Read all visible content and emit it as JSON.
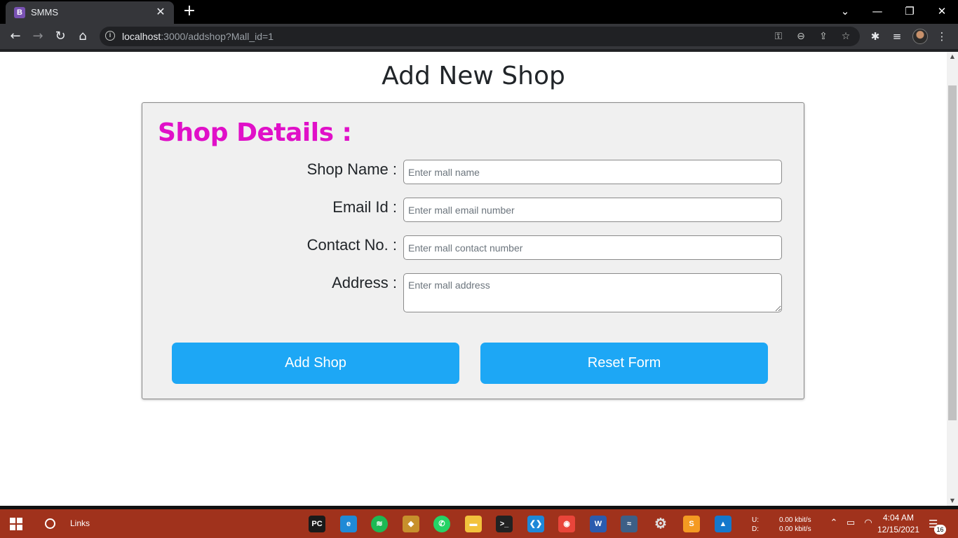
{
  "browser": {
    "tab": {
      "favicon": "B",
      "title": "SMMS",
      "close": "✕"
    },
    "new_tab": "+",
    "window_controls": {
      "dropdown": "⌄",
      "minimize": "—",
      "restore": "❐",
      "close": "✕"
    },
    "nav": {
      "back": "←",
      "forward": "→",
      "reload": "↻",
      "home": "⌂"
    },
    "url_host": "localhost",
    "url_rest": ":3000/addshop?Mall_id=1",
    "omnibox_icons": {
      "key": "⚿",
      "zoom": "⊖",
      "share": "⇪",
      "bookmark": "☆"
    },
    "toolbar_icons": {
      "extensions": "✱",
      "media": "≡"
    }
  },
  "page": {
    "title": "Add New Shop",
    "section_title": "Shop Details :",
    "accent_color": "#e010c8",
    "button_color": "#1da7f5",
    "fields": {
      "shop_name": {
        "label": "Shop Name :",
        "value": "",
        "placeholder": "Enter mall name"
      },
      "email": {
        "label": "Email Id :",
        "value": "",
        "placeholder": "Enter mall email number"
      },
      "contact": {
        "label": "Contact No. :",
        "value": "",
        "placeholder": "Enter mall contact number"
      },
      "address": {
        "label": "Address :",
        "value": "",
        "placeholder": "Enter mall address"
      }
    },
    "buttons": {
      "submit": "Add Shop",
      "reset": "Reset Form"
    }
  },
  "scrollbar": {
    "up": "▲",
    "down": "▼"
  },
  "taskbar": {
    "links_label": "Links",
    "apps": [
      {
        "name": "PyCharm",
        "icon": "pycharm-icon",
        "glyph": "PC",
        "color": "#1a1a1a"
      },
      {
        "name": "Edge",
        "icon": "edge-icon",
        "glyph": "e",
        "color": "#1f8ad6"
      },
      {
        "name": "Spotify",
        "icon": "spotify-icon",
        "glyph": "≋",
        "color": "#1db954"
      },
      {
        "name": "Git",
        "icon": "git-icon",
        "glyph": "◆",
        "color": "#c7902c"
      },
      {
        "name": "WhatsApp",
        "icon": "whatsapp-icon",
        "glyph": "✆",
        "color": "#25d366"
      },
      {
        "name": "File Explorer",
        "icon": "folder-icon",
        "glyph": "▬",
        "color": "#f2c23c"
      },
      {
        "name": "Terminal",
        "icon": "terminal-icon",
        "glyph": ">_",
        "color": "#222"
      },
      {
        "name": "VS Code",
        "icon": "vscode-icon",
        "glyph": "❮❯",
        "color": "#1e88d8"
      },
      {
        "name": "Chrome",
        "icon": "chrome-icon",
        "glyph": "◉",
        "color": "#e9453a"
      },
      {
        "name": "Word",
        "icon": "word-icon",
        "glyph": "W",
        "color": "#2b5bae"
      },
      {
        "name": "MySQL Workbench",
        "icon": "mysql-icon",
        "glyph": "≈",
        "color": "#3d5f86"
      },
      {
        "name": "Settings",
        "icon": "settings-icon",
        "glyph": "⚙",
        "color": "transparent"
      },
      {
        "name": "Sublime Text",
        "icon": "sublime-icon",
        "glyph": "S",
        "color": "#f49a22"
      },
      {
        "name": "Photos",
        "icon": "photos-icon",
        "glyph": "▲",
        "color": "#1478cc"
      }
    ],
    "net_up_label": "U:",
    "net_down_label": "D:",
    "net_up": "0.00 kbit/s",
    "net_down": "0.00 kbit/s",
    "tray": {
      "chevron": "⌃",
      "battery": "▭",
      "wifi": "◠"
    },
    "time": "4:04 AM",
    "date": "12/15/2021",
    "notification_icon": "☰",
    "notification_count": "16"
  }
}
